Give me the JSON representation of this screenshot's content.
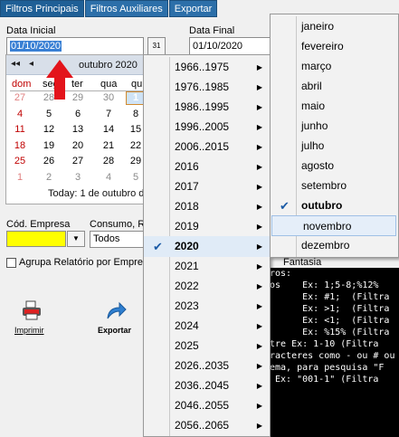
{
  "tabs": [
    "Filtros Principais",
    "Filtros Auxiliares",
    "Exportar"
  ],
  "form": {
    "data_inicial_label": "Data Inicial",
    "data_inicial_value": "01/10/2020",
    "data_final_label": "Data Final",
    "data_final_value": "01/10/2020",
    "cod_empresa_label": "Cód. Empresa",
    "consumo_label": "Consumo, R",
    "consumo_value": "Todos",
    "agrupa_label": "Agrupa Relatório por Empres",
    "fantasia_label": "Fantasia",
    "cal_button_icon": "calendar-icon",
    "cal_button_text": "31"
  },
  "calendar": {
    "nav_prev_year": "◂◂",
    "nav_prev_month": "◂",
    "month_label": "outubro 2020",
    "day_headers": [
      "dom",
      "seg",
      "ter",
      "qua",
      "qu"
    ],
    "rows": [
      [
        "27",
        "28",
        "29",
        "30",
        "1"
      ],
      [
        "4",
        "5",
        "6",
        "7",
        "8"
      ],
      [
        "11",
        "12",
        "13",
        "14",
        "15"
      ],
      [
        "18",
        "19",
        "20",
        "21",
        "22"
      ],
      [
        "25",
        "26",
        "27",
        "28",
        "29"
      ],
      [
        "1",
        "2",
        "3",
        "4",
        "5"
      ]
    ],
    "today_label": "Today:  1 de outubro d"
  },
  "year_menu": {
    "items": [
      "1966..1975",
      "1976..1985",
      "1986..1995",
      "1996..2005",
      "2006..2015",
      "2016",
      "2017",
      "2018",
      "2019",
      "2020",
      "2021",
      "2022",
      "2023",
      "2024",
      "2025",
      "2026..2035",
      "2036..2045",
      "2046..2055",
      "2056..2065"
    ],
    "checked": "2020"
  },
  "month_menu": {
    "items": [
      "janeiro",
      "fevereiro",
      "março",
      "abril",
      "maio",
      "junho",
      "julho",
      "agosto",
      "setembro",
      "outubro",
      "novembro",
      "dezembro"
    ],
    "checked": "outubro",
    "highlighted": "novembro"
  },
  "buttons": {
    "imprimir": "Imprimir",
    "exportar": "Exportar"
  },
  "console_lines": [
    "ros:",
    "os    Ex: 1;5-8;%12%",
    "      Ex: #1;  (Filtra",
    "      Ex: >1;  (Filtra",
    "      Ex: <1;  (Filtra",
    "      Ex: %15% (Filtra",
    "tre Ex: 1-10 (Filtra",
    "racteres como - ou # ou",
    "ema, para pesquisa \"F",
    " Ex: \"001-1\" (Filtra"
  ],
  "colors": {
    "tab_bg": "#2c6fa9",
    "cod_empresa_field": "#ffff00",
    "highlight_arrow": "#e3141b",
    "sunday_text": "#c00000"
  }
}
